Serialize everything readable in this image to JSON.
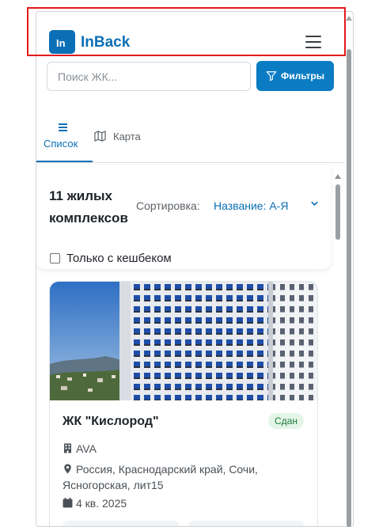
{
  "header": {
    "logo_mark": "In",
    "logo_text": "InBack",
    "menu_icon": "hamburger-menu-icon"
  },
  "search": {
    "placeholder": "Поиск ЖК...",
    "value": ""
  },
  "filters": {
    "label": "Фильтры",
    "icon": "filter-funnel-icon"
  },
  "tabs": [
    {
      "label": "Список",
      "icon": "list-icon",
      "active": true
    },
    {
      "label": "Карта",
      "icon": "map-icon",
      "active": false
    }
  ],
  "results": {
    "count_line1": "11 жилых",
    "count_line2": "комплексов",
    "sort_label": "Сортировка:",
    "sort_value": "Название: А-Я",
    "cashback_label": "Только с кешбеком",
    "cashback_checked": false
  },
  "card": {
    "title": "ЖК \"Кислород\"",
    "status": "Сдан",
    "developer": "AVA",
    "address": "Россия, Краснодарский край, Сочи, Ясногорская, лит15",
    "deadline": "4 кв. 2025"
  },
  "colors": {
    "brand": "#0b6fb6",
    "button": "#0b7cc4",
    "badge_bg": "#e4f5e8",
    "badge_text": "#1b7a38",
    "highlight": "#e31a1a"
  }
}
